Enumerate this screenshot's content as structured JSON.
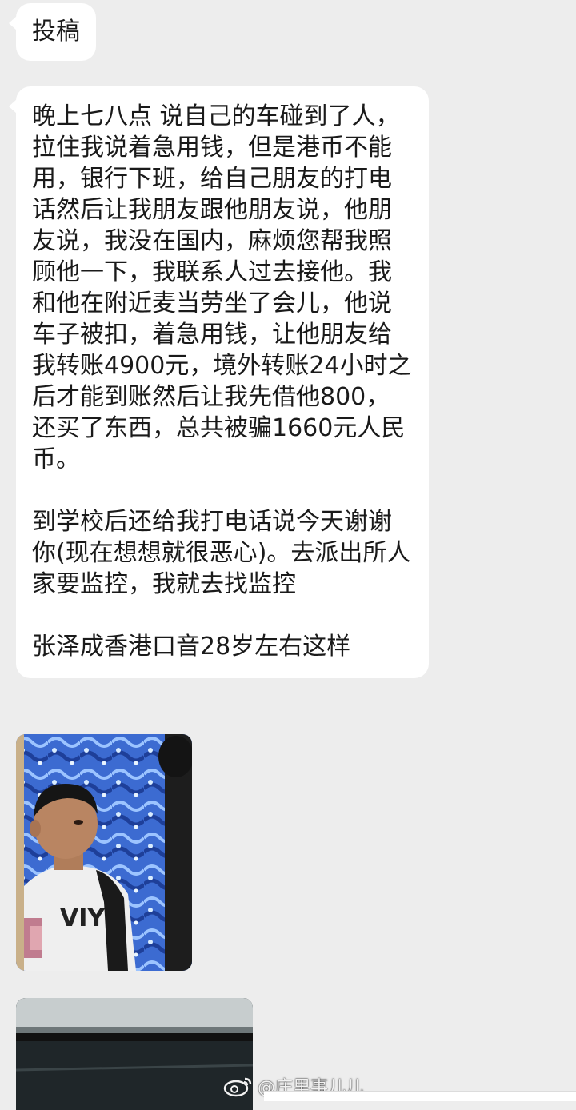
{
  "messages": [
    {
      "type": "text",
      "text": "投稿"
    },
    {
      "type": "text",
      "paragraphs": [
        "晚上七八点 说自己的车碰到了人，拉住我说着急用钱，但是港币不能用，银行下班，给自己朋友的打电话然后让我朋友跟他朋友说，他朋友说，我没在国内，麻烦您帮我照顾他一下，我联系人过去接他。我和他在附近麦当劳坐了会儿，他说车子被扣，着急用钱，让他朋友给我转账4900元，境外转账24小时之后才能到账然后让我先借他800，还买了东西，总共被骗1660元人民币。",
        "到学校后还给我打电话说今天谢谢你(现在想想就很恶心)。去派出所人家要监控，我就去找监控",
        "张泽成香港口音28岁左右这样"
      ]
    },
    {
      "type": "image",
      "subject": "surveillance-photo-man"
    },
    {
      "type": "image",
      "subject": "surveillance-photo-2"
    }
  ],
  "watermark": {
    "icon": "weibo-icon",
    "text": "@庄里事儿儿"
  },
  "colors": {
    "background": "#ededed",
    "bubble": "#ffffff",
    "text": "#1a1a1a"
  }
}
